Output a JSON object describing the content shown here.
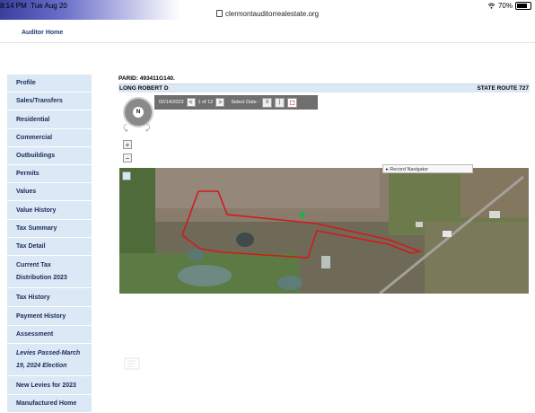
{
  "status_bar": {
    "time": "8:14 PM",
    "date": "Tue Aug 20",
    "url": "clermontauditorrealestate.org",
    "battery": "70%"
  },
  "header": {
    "auditor_home": "Auditor Home"
  },
  "sidebar": {
    "items": [
      {
        "label": "Profile"
      },
      {
        "label": "Sales/Transfers"
      },
      {
        "label": "Residential"
      },
      {
        "label": "Commercial"
      },
      {
        "label": "Outbuildings"
      },
      {
        "label": "Permits"
      },
      {
        "label": "Values"
      },
      {
        "label": "Value History"
      },
      {
        "label": "Tax Summary"
      },
      {
        "label": "Tax Detail"
      },
      {
        "label": "Current Tax"
      },
      {
        "label": "Distribution 2023"
      },
      {
        "label": "Tax History"
      },
      {
        "label": "Payment History"
      },
      {
        "label": "Assessment"
      },
      {
        "label": "Levies Passed-March"
      },
      {
        "label": "19, 2024 Election"
      },
      {
        "label": "New Levies for 2023"
      },
      {
        "label": "Manufactured Home"
      }
    ]
  },
  "parcel": {
    "parid_label": "PARID: 493411G140.",
    "owner": "LONG ROBERT D",
    "address": "STATE ROUTE 727"
  },
  "map_toolbar": {
    "date": "02/14/2023",
    "record": "1 of 12",
    "select_date": "Select Date -",
    "prev": "<",
    "next": ">"
  },
  "map": {
    "record_navigator": "Record Navigator",
    "parcel_outline_color": "#d11a1a",
    "marker_color": "#18b14a"
  },
  "compass": {
    "north": "N"
  }
}
